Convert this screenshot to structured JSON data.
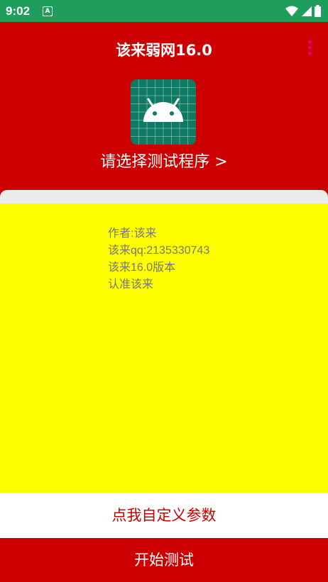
{
  "status_bar": {
    "time": "9:02",
    "notification_icon": "A"
  },
  "app_bar": {
    "title": "该来弱网16.0"
  },
  "header": {
    "select_program": "请选择测试程序 >"
  },
  "info": {
    "lines": [
      "作者:该来",
      "该来qq:2135330743",
      "该来16.0版本",
      "认准该来"
    ]
  },
  "buttons": {
    "custom_params": "点我自定义参数",
    "start_test": "开始测试"
  },
  "colors": {
    "primary": "#cc0000",
    "status_bar": "#1e9e5a",
    "content_bg": "#ffff00",
    "menu_accent": "#e0007a"
  }
}
